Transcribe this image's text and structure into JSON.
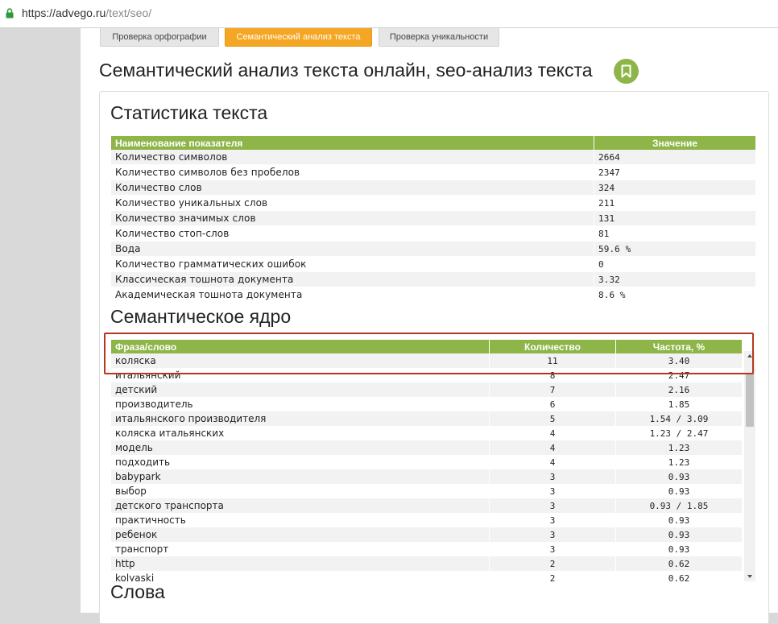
{
  "browser": {
    "url_base": "https://advego.ru",
    "url_path": "/text/seo/"
  },
  "tabs": [
    {
      "label": "Проверка орфографии"
    },
    {
      "label": "Семантический анализ текста"
    },
    {
      "label": "Проверка уникальности"
    }
  ],
  "page": {
    "title": "Семантический анализ текста онлайн, seo-анализ текста",
    "bookmark_icon": "bookmark-icon"
  },
  "stats": {
    "title": "Статистика текста",
    "headers": {
      "name": "Наименование показателя",
      "value": "Значение"
    },
    "rows": [
      {
        "name": "Количество символов",
        "value": "2664"
      },
      {
        "name": "Количество символов без пробелов",
        "value": "2347"
      },
      {
        "name": "Количество слов",
        "value": "324"
      },
      {
        "name": "Количество уникальных слов",
        "value": "211"
      },
      {
        "name": "Количество значимых слов",
        "value": "131"
      },
      {
        "name": "Количество стоп-слов",
        "value": "81"
      },
      {
        "name": "Вода",
        "value": "59.6 %"
      },
      {
        "name": "Количество грамматических ошибок",
        "value": "0"
      },
      {
        "name": "Классическая тошнота документа",
        "value": "3.32"
      },
      {
        "name": "Академическая тошнота документа",
        "value": "8.6 %"
      }
    ]
  },
  "core": {
    "title": "Семантическое ядро",
    "headers": {
      "phrase": "Фраза/слово",
      "count": "Количество",
      "freq": "Частота, %"
    },
    "rows": [
      {
        "phrase": "коляска",
        "count": "11",
        "freq": "3.40"
      },
      {
        "phrase": "итальянский",
        "count": "8",
        "freq": "2.47"
      },
      {
        "phrase": "детский",
        "count": "7",
        "freq": "2.16"
      },
      {
        "phrase": "производитель",
        "count": "6",
        "freq": "1.85"
      },
      {
        "phrase": "итальянского производителя",
        "count": "5",
        "freq": "1.54 / 3.09"
      },
      {
        "phrase": "коляска итальянских",
        "count": "4",
        "freq": "1.23 / 2.47"
      },
      {
        "phrase": "модель",
        "count": "4",
        "freq": "1.23"
      },
      {
        "phrase": "подходить",
        "count": "4",
        "freq": "1.23"
      },
      {
        "phrase": "babypark",
        "count": "3",
        "freq": "0.93"
      },
      {
        "phrase": "выбор",
        "count": "3",
        "freq": "0.93"
      },
      {
        "phrase": "детского транспорта",
        "count": "3",
        "freq": "0.93 / 1.85"
      },
      {
        "phrase": "практичность",
        "count": "3",
        "freq": "0.93"
      },
      {
        "phrase": "ребенок",
        "count": "3",
        "freq": "0.93"
      },
      {
        "phrase": "транспорт",
        "count": "3",
        "freq": "0.93"
      },
      {
        "phrase": "http",
        "count": "2",
        "freq": "0.62"
      },
      {
        "phrase": "kolyaski",
        "count": "2",
        "freq": "0.62"
      }
    ]
  },
  "words": {
    "title": "Слова"
  },
  "colors": {
    "accent_green": "#8db548",
    "active_tab_orange": "#f5a623",
    "highlight_red": "#b5381e"
  }
}
